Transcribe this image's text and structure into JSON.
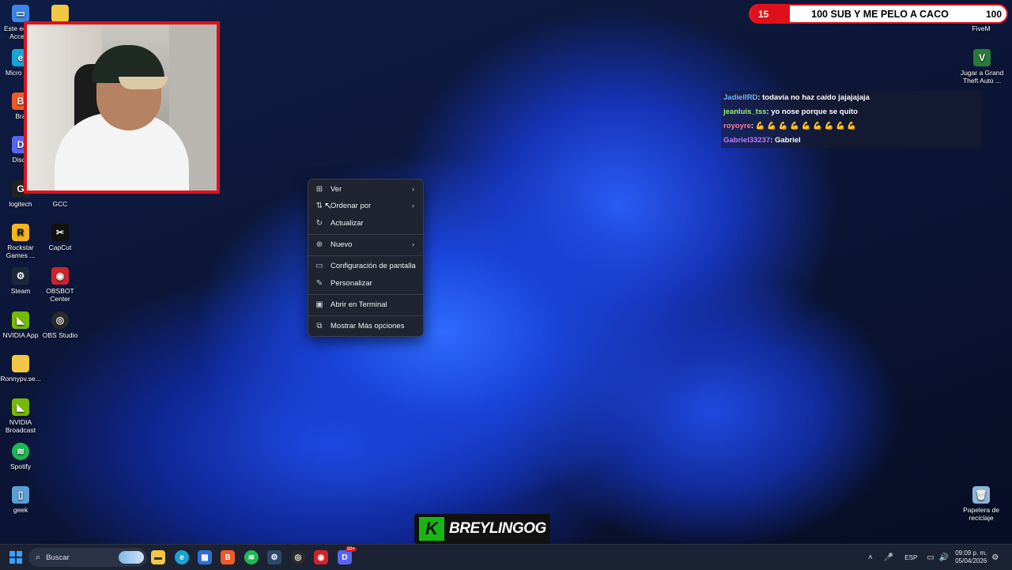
{
  "desktop": {
    "left_icons": [
      {
        "label": "Este equ… Acceso",
        "icon": "pc-icon",
        "color": "#3a86e8"
      },
      {
        "label": "Micro Edg",
        "icon": "edge-icon",
        "color": "#1aa3d6"
      },
      {
        "label": "Bra",
        "icon": "brave-icon",
        "color": "#f15a24"
      },
      {
        "label": "Disco",
        "icon": "discord-icon",
        "color": "#5865f2"
      },
      {
        "label": "logitech",
        "icon": "logitech-icon",
        "color": "#222222"
      },
      {
        "label": "GCC",
        "icon": "gcc-icon",
        "color": "#e8c54a"
      },
      {
        "label": "Rockstar Games ...",
        "icon": "rockstar-icon",
        "color": "#f6b51a"
      },
      {
        "label": "CapCut",
        "icon": "capcut-icon",
        "color": "#111111"
      },
      {
        "label": "Steam",
        "icon": "steam-icon",
        "color": "#1b2a3a"
      },
      {
        "label": "OBSBOT Center",
        "icon": "obsbot-icon",
        "color": "#d1232a"
      },
      {
        "label": "NVIDIA App",
        "icon": "nvidia-icon",
        "color": "#76b900"
      },
      {
        "label": "OBS Studio",
        "icon": "obs-icon",
        "color": "#2b2b2b"
      },
      {
        "label": "Ronnypv.se...",
        "icon": "folder-icon",
        "color": "#f2c744"
      },
      {
        "label": "NVIDIA Broadcast",
        "icon": "nvidia-broadcast-icon",
        "color": "#76b900"
      },
      {
        "label": "Spotify",
        "icon": "spotify-icon",
        "color": "#1db954"
      },
      {
        "label": "geek",
        "icon": "geek-icon",
        "color": "#5aa0d8"
      }
    ],
    "right_icons": [
      {
        "label": "FiveM",
        "icon": "fivem-icon",
        "color": "#e06a2a"
      },
      {
        "label": "Jugar a Grand Theft Auto ...",
        "icon": "gta-icon",
        "color": "#2a7a3a"
      },
      {
        "label": "Papelera de reciclaje",
        "icon": "recycle-bin-icon",
        "color": "#8fb6d6"
      }
    ]
  },
  "goal_bar": {
    "left_value": "15",
    "title": "100 SUB Y ME PELO A CACO",
    "right_value": "100",
    "accent": "#e0101a"
  },
  "chat": [
    {
      "user": "JadielIRD",
      "message": ": todavía no haz caído jajajajaja",
      "color": "#6fb3ff"
    },
    {
      "user": "jeanluis_tss",
      "message": ": yo nose porque se quito",
      "color": "#9ef07a"
    },
    {
      "user": "royoyre",
      "message": ": 💪 💪 💪 💪 💪 💪 💪 💪 💪",
      "color": "#ff7a9a"
    },
    {
      "user": "Gabriel33237",
      "message": ": Gabriel",
      "color": "#c07aff"
    }
  ],
  "context_menu": {
    "items": [
      {
        "label": "Ver",
        "icon": "grid-icon",
        "submenu": true
      },
      {
        "label": "Ordenar por",
        "icon": "sort-icon",
        "submenu": true
      },
      {
        "label": "Actualizar",
        "icon": "refresh-icon",
        "submenu": false
      },
      {
        "label": "Nuevo",
        "icon": "plus-circle-icon",
        "submenu": true
      },
      {
        "label": "Configuración de pantalla",
        "icon": "display-icon",
        "submenu": false
      },
      {
        "label": "Personalizar",
        "icon": "pen-icon",
        "submenu": false
      },
      {
        "label": "Abrir en Terminal",
        "icon": "terminal-icon",
        "submenu": false
      },
      {
        "label": "Mostrar Más opciones",
        "icon": "share-icon",
        "submenu": false
      }
    ]
  },
  "brand": {
    "letter": "K",
    "name": "BREYLINGOG"
  },
  "taskbar": {
    "search_placeholder": "Buscar",
    "apps": [
      "file-explorer-icon",
      "edge-icon",
      "store-icon",
      "brave-icon",
      "spotify-icon",
      "steam-icon",
      "obs-icon",
      "obsbot-icon",
      "discord-icon"
    ],
    "discord_badge": "99+",
    "language": "ESP",
    "time": "09:09 p. m.",
    "date": "05/04/2026"
  }
}
